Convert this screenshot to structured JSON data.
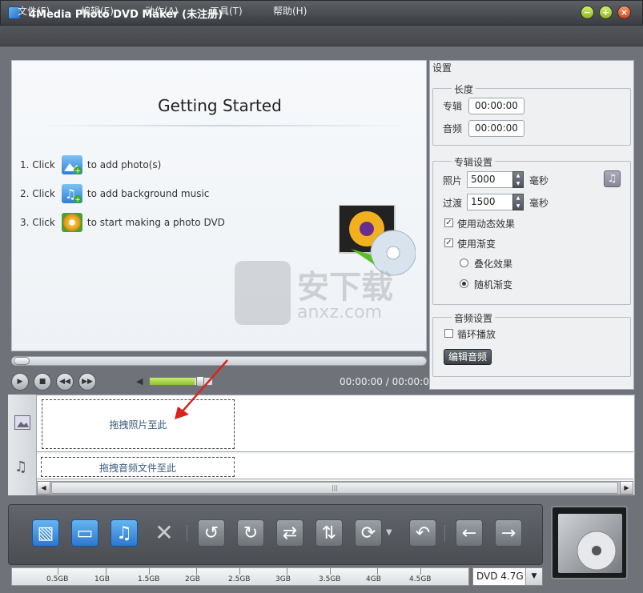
{
  "window": {
    "title": "4Media Photo DVD Maker (未注册)",
    "min_label": "−",
    "max_label": "+",
    "close_label": "×"
  },
  "menu": [
    "文件(F)",
    "编辑(E)",
    "动作(A)",
    "工具(T)",
    "帮助(H)"
  ],
  "preview": {
    "title": "Getting Started",
    "steps": [
      {
        "prefix": "1. Click",
        "text": "to add photo(s)",
        "icon": "add-photo-icon"
      },
      {
        "prefix": "2. Click",
        "text": "to add background music",
        "icon": "add-music-icon"
      },
      {
        "prefix": "3. Click",
        "text": "to start making a photo DVD",
        "icon": "make-dvd-icon"
      }
    ],
    "watermark_text": "安下载",
    "watermark_sub": "anxz.com"
  },
  "player": {
    "time": "00:00:00 / 00:00:00",
    "volume_fraction": 0.72
  },
  "settings": {
    "title": "设置",
    "length": {
      "legend": "长度",
      "album_label": "专辑",
      "album_value": "00:00:00",
      "audio_label": "音频",
      "audio_value": "00:00:00"
    },
    "album": {
      "legend": "专辑设置",
      "photo_label": "照片",
      "photo_value": "5000",
      "photo_unit": "毫秒",
      "transition_label": "过渡",
      "transition_value": "1500",
      "transition_unit": "毫秒",
      "dynamic_label": "使用动态效果",
      "dynamic_checked": true,
      "fade_label": "使用渐变",
      "fade_checked": true,
      "overlay_label": "叠化效果",
      "random_label": "随机渐变",
      "selected": "random"
    },
    "audio": {
      "legend": "音频设置",
      "loop_label": "循环播放",
      "loop_checked": false,
      "edit_label": "编辑音频"
    }
  },
  "timeline": {
    "photo_drop": "拖拽照片至此",
    "audio_drop": "拖拽音频文件至此"
  },
  "capacity": {
    "labels": [
      "0.5GB",
      "1GB",
      "1.5GB",
      "2GB",
      "2.5GB",
      "3GB",
      "3.5GB",
      "4GB",
      "4.5GB"
    ],
    "disc": "DVD 4.7G"
  },
  "colors": {
    "accent": "#2b78d1",
    "volume": "#89c22a",
    "frame": "#6f7379"
  }
}
